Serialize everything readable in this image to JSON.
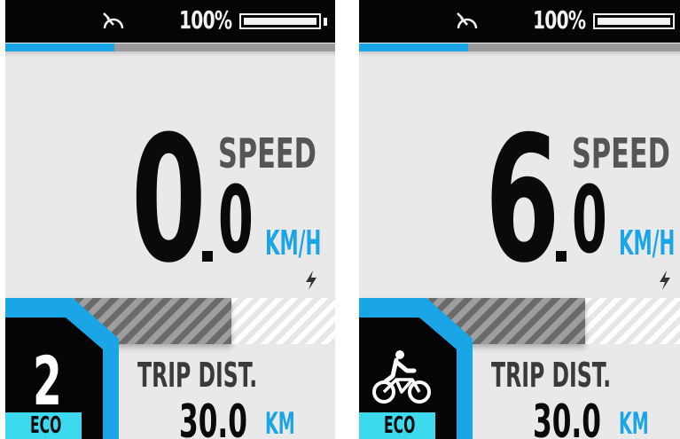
{
  "screens": [
    {
      "status": {
        "battery_percent": "100%",
        "battery_level": 1.0,
        "progress_fraction": 0.33,
        "icon": "speedometer-icon"
      },
      "speed": {
        "integer": "0",
        "decimal": "0",
        "label": "SPEED",
        "unit": "KM/H",
        "charge_icon": "bolt-icon"
      },
      "assist": {
        "level": "2",
        "mode": "ECO",
        "icon": ""
      },
      "trip": {
        "label": "TRIP DIST.",
        "value": "30.0",
        "unit": "KM"
      }
    },
    {
      "status": {
        "battery_percent": "100%",
        "battery_level": 1.0,
        "progress_fraction": 0.33,
        "icon": "speedometer-icon"
      },
      "speed": {
        "integer": "6",
        "decimal": "0",
        "label": "SPEED",
        "unit": "KM/H",
        "charge_icon": "bolt-icon"
      },
      "assist": {
        "level": "",
        "mode": "ECO",
        "icon": "walk-assist-icon"
      },
      "trip": {
        "label": "TRIP DIST.",
        "value": "30.0",
        "unit": "KM"
      }
    }
  ],
  "colors": {
    "accent": "#1aa5e6",
    "eco_tab": "#3dd9ef",
    "status_bar": "#050505",
    "screen_bg": "#e9e9e9"
  }
}
